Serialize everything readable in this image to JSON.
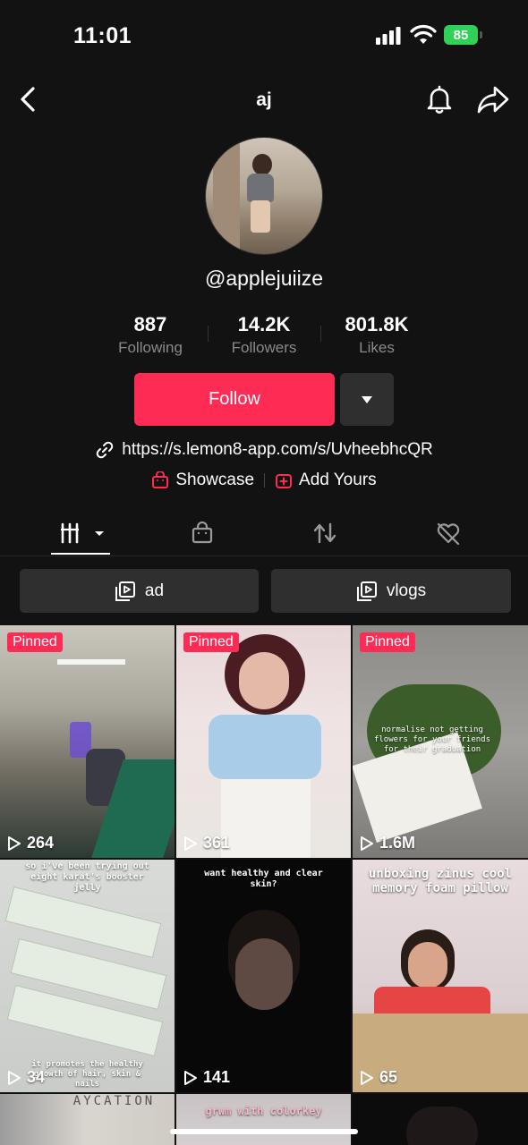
{
  "status_bar": {
    "time": "11:01",
    "battery": "85"
  },
  "nav": {
    "title": "aj"
  },
  "profile": {
    "username": "@applejuiize",
    "stats": [
      {
        "value": "887",
        "label": "Following"
      },
      {
        "value": "14.2K",
        "label": "Followers"
      },
      {
        "value": "801.8K",
        "label": "Likes"
      }
    ],
    "follow_label": "Follow",
    "link": "https://s.lemon8-app.com/s/UvheebhcQR",
    "showcase_label": "Showcase",
    "add_yours_label": "Add Yours"
  },
  "playlists": [
    {
      "label": "ad"
    },
    {
      "label": "vlogs"
    }
  ],
  "videos": [
    {
      "pinned": "Pinned",
      "views": "264"
    },
    {
      "pinned": "Pinned",
      "views": "361"
    },
    {
      "pinned": "Pinned",
      "views": "1.6M",
      "caption": "normalise not getting flowers for your friends for their graduation"
    },
    {
      "views": "34",
      "caption": "so i've been trying out eight karat's booster jelly",
      "caption2": "it promotes the healthy growth of hair, skin & nails"
    },
    {
      "views": "141",
      "caption": "want healthy and clear skin?"
    },
    {
      "views": "65",
      "caption": "unboxing zinus cool memory foam pillow"
    },
    {
      "caption": "AYCATION"
    },
    {
      "caption": "grwm with colorkey"
    },
    {}
  ],
  "colors": {
    "accent": "#fe2c55",
    "background": "#121212",
    "button_dark": "#2f2f2f",
    "battery": "#30d158"
  }
}
